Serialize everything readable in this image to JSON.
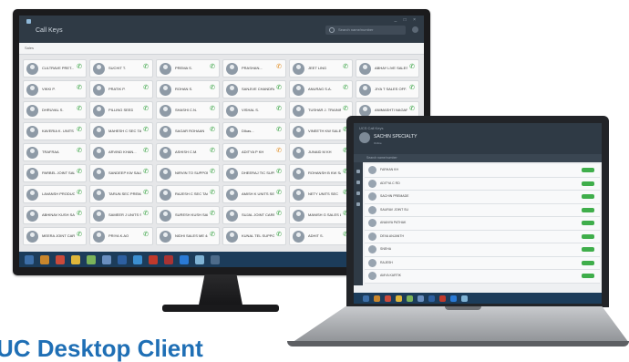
{
  "caption": "UC Desktop Client",
  "desktop_app": {
    "title": "Call Keys",
    "search_placeholder": "Search name/number",
    "tab": "Sales",
    "cards": [
      {
        "name": "CULTRAVE PRET...",
        "status": "",
        "phone_color": "green"
      },
      {
        "name": "SUCHIT T.",
        "status": "",
        "phone_color": "green"
      },
      {
        "name": "PREMA S.",
        "status": "",
        "phone_color": "green"
      },
      {
        "name": "PRASHAN...",
        "status": "",
        "phone_color": "orange"
      },
      {
        "name": "JEET LING",
        "status": "",
        "phone_color": "green"
      },
      {
        "name": "ABHAY LIVE SALES",
        "status": "",
        "phone_color": "green"
      },
      {
        "name": "VIKKI P.",
        "status": "",
        "phone_color": "green"
      },
      {
        "name": "PRATIK P.",
        "status": "",
        "phone_color": "green"
      },
      {
        "name": "ROHAN S.",
        "status": "",
        "phone_color": "green"
      },
      {
        "name": "SANJIVE CHANDRAN",
        "status": "",
        "phone_color": "green"
      },
      {
        "name": "ANURAG S.A.",
        "status": "",
        "phone_color": "green"
      },
      {
        "name": "JIYA T SALES OFF.",
        "status": "",
        "phone_color": "green"
      },
      {
        "name": "DHRUVAL S.",
        "status": "",
        "phone_color": "green"
      },
      {
        "name": "PILLING SEED",
        "status": "",
        "phone_color": "green"
      },
      {
        "name": "SHASHI C.N.",
        "status": "",
        "phone_color": "green"
      },
      {
        "name": "VISHAL S.",
        "status": "",
        "phone_color": "green"
      },
      {
        "name": "TUSHAR J. TRAINING",
        "status": "",
        "phone_color": "green"
      },
      {
        "name": "ANIMASHTI NAGAR",
        "status": "",
        "phone_color": "green"
      },
      {
        "name": "KAVERIA K. UNITS SEC",
        "status": "",
        "phone_color": "green"
      },
      {
        "name": "MAHESH C SEC TAC",
        "status": "",
        "phone_color": "green"
      },
      {
        "name": "SAGAR ROHAAN",
        "status": "",
        "phone_color": "green"
      },
      {
        "name": "DIkas...",
        "status": "",
        "phone_color": "green"
      },
      {
        "name": "VINEETH KW SALES",
        "status": "",
        "phone_color": "green"
      },
      {
        "name": "KAPIL ROSHAN",
        "status": "",
        "phone_color": "green"
      },
      {
        "name": "TRAFRAA",
        "status": "",
        "phone_color": "green"
      },
      {
        "name": "ARVIND KHAN...",
        "status": "",
        "phone_color": "green"
      },
      {
        "name": "ASHISH C.M.",
        "status": "",
        "phone_color": "green"
      },
      {
        "name": "ADITYA P KH",
        "status": "",
        "phone_color": "orange"
      },
      {
        "name": "JUNAID M KH",
        "status": "",
        "phone_color": "green"
      },
      {
        "name": "",
        "status": "",
        "phone_color": "green"
      },
      {
        "name": "PARBEL JOINT SALES",
        "status": "",
        "phone_color": "green"
      },
      {
        "name": "SANDEEP KW SALES",
        "status": "",
        "phone_color": "green"
      },
      {
        "name": "NIRVIN TO SUPPORT",
        "status": "",
        "phone_color": "green"
      },
      {
        "name": "DHEERAJ TIC SUPPORT",
        "status": "",
        "phone_color": "green"
      },
      {
        "name": "ROHANSH B KW SALES",
        "status": "",
        "phone_color": "green"
      },
      {
        "name": "",
        "status": "",
        "phone_color": "green"
      },
      {
        "name": "LAVANSH PRODUCT",
        "status": "",
        "phone_color": "green"
      },
      {
        "name": "TARUN SEC PREMADE",
        "status": "",
        "phone_color": "green"
      },
      {
        "name": "RAJESH C SEC TAC",
        "status": "",
        "phone_color": "green"
      },
      {
        "name": "AMISH K UNITS SEC",
        "status": "",
        "phone_color": "green"
      },
      {
        "name": "NETY UNITS SEC",
        "status": "",
        "phone_color": "green"
      },
      {
        "name": "",
        "status": "",
        "phone_color": "green"
      },
      {
        "name": "ABHINAV KUSH SALES",
        "status": "",
        "phone_color": "green"
      },
      {
        "name": "SAMEER J UNITS SEC",
        "status": "",
        "phone_color": "green"
      },
      {
        "name": "SURESH KUSH SALES",
        "status": "",
        "phone_color": "green"
      },
      {
        "name": "SUJAL JOINT CARE",
        "status": "",
        "phone_color": "green"
      },
      {
        "name": "MANISH G SALES LINE",
        "status": "",
        "phone_color": "green"
      },
      {
        "name": "",
        "status": "",
        "phone_color": "green"
      },
      {
        "name": "MEERA JOINT CARE",
        "status": "",
        "phone_color": "green"
      },
      {
        "name": "PRIYA K.AO",
        "status": "",
        "phone_color": "green"
      },
      {
        "name": "NIDHI SALES ME 4409",
        "status": "",
        "phone_color": "green"
      },
      {
        "name": "KUNAL TEL SUPPORT",
        "status": "",
        "phone_color": "green"
      },
      {
        "name": "ADHIT S.",
        "status": "",
        "phone_color": "green"
      },
      {
        "name": "",
        "status": "",
        "phone_color": "green"
      }
    ],
    "taskbar_icons": [
      "#3d6fa8",
      "#c9862c",
      "#cc4a3a",
      "#dfb63a",
      "#7bb35a",
      "#6a8fc0",
      "#2d5fa0",
      "#3c8fd1",
      "#c0392b",
      "#a33",
      "#2a7ad6",
      "#7fb3d5",
      "#4d6b8a"
    ],
    "clock": "12:41"
  },
  "laptop_app": {
    "title": "UCS Call Keys",
    "user_name": "SACHIN SPECIALTY",
    "user_status": "Online",
    "search_placeholder": "Search name/number",
    "contacts": [
      "FARHAN KH",
      "ADITYA C RD",
      "SACHIN PREMADE",
      "SAURAV JOINT SU",
      "ANANYA PATHAK",
      "DEVA ANJANTH",
      "SNEHA",
      "RAJESH",
      "AMYA KARTIK"
    ],
    "taskbar_icons": [
      "#3d6fa8",
      "#c9862c",
      "#cc4a3a",
      "#dfb63a",
      "#7bb35a",
      "#6a8fc0",
      "#2d5fa0",
      "#c0392b",
      "#2a7ad6",
      "#7fb3d5"
    ]
  }
}
